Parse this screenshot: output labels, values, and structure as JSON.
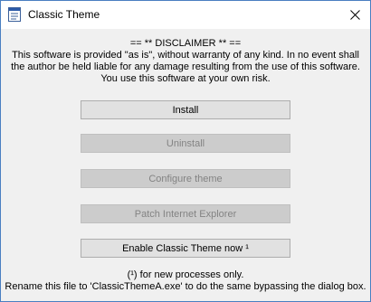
{
  "window": {
    "title": "Classic Theme",
    "icon": "window-app-icon",
    "close_icon": "close-icon"
  },
  "disclaimer": {
    "heading": "== ** DISCLAIMER ** ==",
    "line1": "This software is provided \"as is\", without warranty of any kind. In no event shall",
    "line2": "the author be held liable for any damage resulting from the use of this software.",
    "line3": "You use this software at your own risk."
  },
  "buttons": {
    "install": "Install",
    "uninstall": "Uninstall",
    "configure": "Configure theme",
    "patch_ie": "Patch Internet Explorer",
    "enable_now": "Enable Classic Theme now ¹"
  },
  "footer": {
    "note1": "(¹) for new processes only.",
    "note2": "Rename this file to 'ClassicThemeA.exe' to do the same bypassing the dialog box."
  }
}
